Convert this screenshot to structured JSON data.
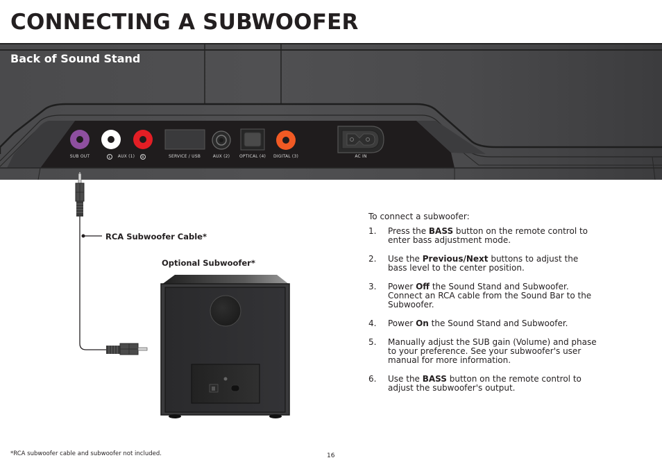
{
  "page": {
    "title": "CONNECTING A SUBWOOFER",
    "number": "16",
    "footnote": "*RCA subwoofer cable and subwoofer not included."
  },
  "stand": {
    "section_title": "Back of Sound Stand",
    "ports": [
      {
        "id": "sub-out",
        "label": "SUB OUT",
        "color": "#8e4f9f"
      },
      {
        "id": "aux1-left",
        "label": "L",
        "color": "#ffffff"
      },
      {
        "id": "aux1",
        "label": "AUX (1)"
      },
      {
        "id": "aux1-right",
        "label": "R",
        "color": "#e31e25"
      },
      {
        "id": "service-usb",
        "label": "SERVICE / USB"
      },
      {
        "id": "aux2",
        "label": "AUX (2)"
      },
      {
        "id": "optical",
        "label": "OPTICAL (4)"
      },
      {
        "id": "digital",
        "label": "DIGITAL (3)",
        "color": "#f15a24"
      },
      {
        "id": "ac-in",
        "label": "AC IN"
      }
    ]
  },
  "diagram": {
    "cable_label": "RCA Subwoofer Cable*",
    "subwoofer_label": "Optional Subwoofer*"
  },
  "instructions": {
    "intro": "To connect a subwoofer:",
    "steps": [
      {
        "num": "1.",
        "before": "Press the ",
        "bold": "BASS",
        "after": " button on the remote control to enter bass adjustment mode."
      },
      {
        "num": "2.",
        "before": "Use the ",
        "bold": "Previous/Next",
        "after": " buttons to adjust the bass level to the center position."
      },
      {
        "num": "3.",
        "before": "Power ",
        "bold": "Off",
        "after": " the Sound Stand and Subwoofer. Connect an RCA cable from the Sound Bar to the Subwoofer."
      },
      {
        "num": "4.",
        "before": "Power ",
        "bold": "On",
        "after": " the Sound Stand and Subwoofer."
      },
      {
        "num": "5.",
        "before": "",
        "bold": "",
        "after": "Manually adjust the SUB gain (Volume) and phase to your preference. See your subwoofer's user manual for more information."
      },
      {
        "num": "6.",
        "before": "Use the ",
        "bold": "BASS",
        "after": " button on the remote control to adjust the subwoofer's output."
      }
    ]
  }
}
